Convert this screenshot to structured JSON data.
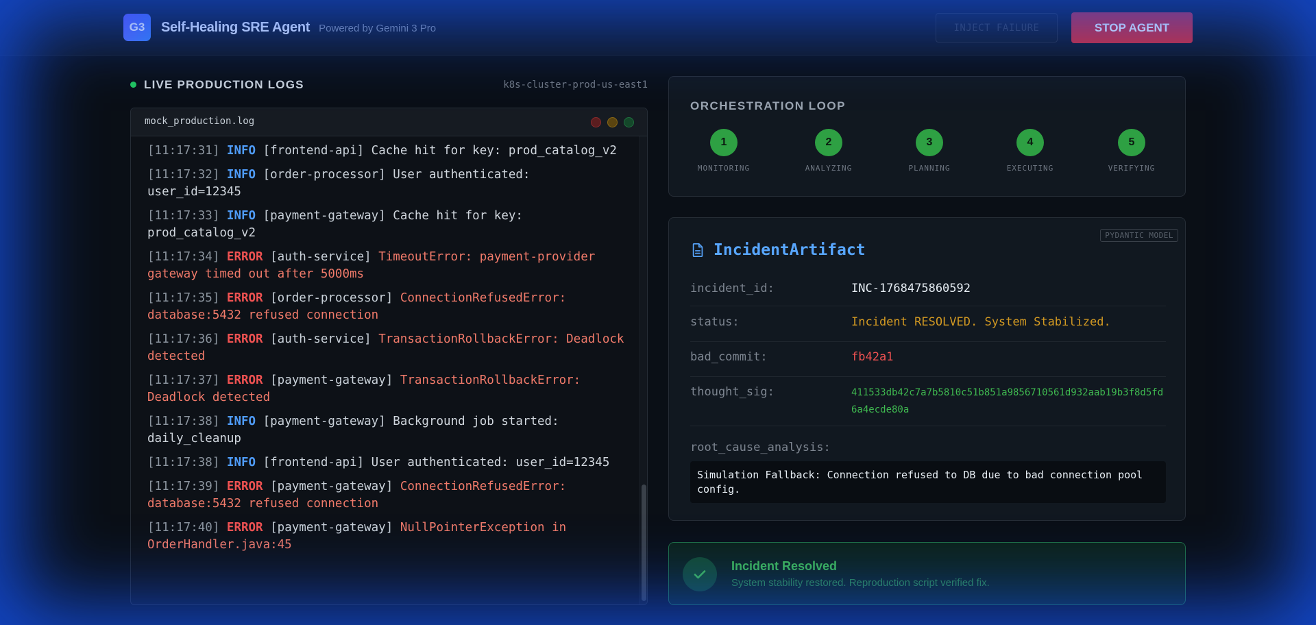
{
  "header": {
    "logo_text": "G3",
    "title": "Self-Healing SRE Agent",
    "subtitle": "Powered by Gemini 3 Pro",
    "inject_label": "INJECT FAILURE",
    "stop_label": "STOP AGENT"
  },
  "logs": {
    "section_title": "LIVE PRODUCTION LOGS",
    "cluster": "k8s-cluster-prod-us-east1",
    "file_name": "mock_production.log",
    "lines": [
      {
        "ts": "[11:17:31]",
        "level": "INFO",
        "service": "[frontend-api]",
        "message": "Cache hit for key: prod_catalog_v2"
      },
      {
        "ts": "[11:17:32]",
        "level": "INFO",
        "service": "[order-processor]",
        "message": "User authenticated: user_id=12345"
      },
      {
        "ts": "[11:17:33]",
        "level": "INFO",
        "service": "[payment-gateway]",
        "message": "Cache hit for key: prod_catalog_v2"
      },
      {
        "ts": "[11:17:34]",
        "level": "ERROR",
        "service": "[auth-service]",
        "message": "TimeoutError: payment-provider gateway timed out after 5000ms"
      },
      {
        "ts": "[11:17:35]",
        "level": "ERROR",
        "service": "[order-processor]",
        "message": "ConnectionRefusedError: database:5432 refused connection"
      },
      {
        "ts": "[11:17:36]",
        "level": "ERROR",
        "service": "[auth-service]",
        "message": "TransactionRollbackError: Deadlock detected"
      },
      {
        "ts": "[11:17:37]",
        "level": "ERROR",
        "service": "[payment-gateway]",
        "message": "TransactionRollbackError: Deadlock detected"
      },
      {
        "ts": "[11:17:38]",
        "level": "INFO",
        "service": "[payment-gateway]",
        "message": "Background job started: daily_cleanup"
      },
      {
        "ts": "[11:17:38]",
        "level": "INFO",
        "service": "[frontend-api]",
        "message": "User authenticated: user_id=12345"
      },
      {
        "ts": "[11:17:39]",
        "level": "ERROR",
        "service": "[payment-gateway]",
        "message": "ConnectionRefusedError: database:5432 refused connection"
      },
      {
        "ts": "[11:17:40]",
        "level": "ERROR",
        "service": "[payment-gateway]",
        "message": "NullPointerException in OrderHandler.java:45"
      }
    ]
  },
  "orchestration": {
    "title": "ORCHESTRATION LOOP",
    "steps": [
      {
        "number": "1",
        "label": "MONITORING"
      },
      {
        "number": "2",
        "label": "ANALYZING"
      },
      {
        "number": "3",
        "label": "PLANNING"
      },
      {
        "number": "4",
        "label": "EXECUTING"
      },
      {
        "number": "5",
        "label": "VERIFYING"
      }
    ]
  },
  "artifact": {
    "badge": "PYDANTIC MODEL",
    "title": "IncidentArtifact",
    "fields": {
      "incident_id": {
        "key": "incident_id:",
        "value": "INC-1768475860592"
      },
      "status": {
        "key": "status:",
        "value": "Incident RESOLVED. System Stabilized."
      },
      "bad_commit": {
        "key": "bad_commit:",
        "value": "fb42a1"
      },
      "thought_sig": {
        "key": "thought_sig:",
        "value": "411533db42c7a7b5810c51b851a9856710561d932aab19b3f8d5fd6a4ecde80a"
      }
    },
    "rca_label": "root_cause_analysis:",
    "rca_text": "Simulation Fallback: Connection refused to DB due to bad connection pool config."
  },
  "resolved": {
    "title": "Incident Resolved",
    "subtitle": "System stability restored. Reproduction script verified fix."
  },
  "colors": {
    "accent_blue": "#58a6ff",
    "success_green": "#2ea043",
    "error_red": "#f05252",
    "stop_button": "#d62a2f",
    "status_amber": "#d29922"
  },
  "icons": {
    "artifact": "document-icon",
    "resolved": "check-icon",
    "live": "status-dot-icon"
  }
}
